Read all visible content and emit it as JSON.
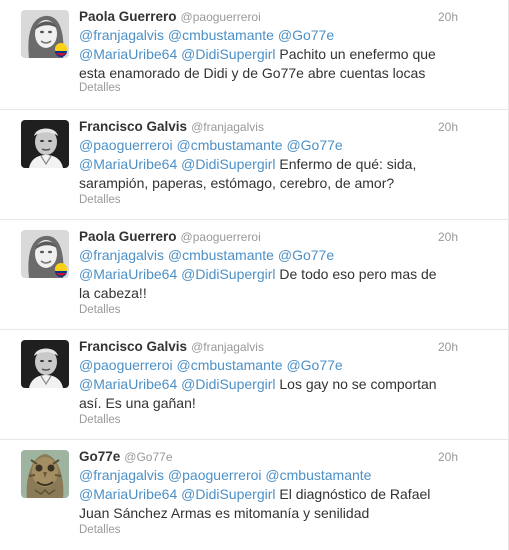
{
  "tweets": [
    {
      "name": "Paola Guerrero",
      "handle": "@paoguerreroi",
      "time": "20h",
      "mentions": [
        "@franjagalvis",
        "@cmbustamante",
        "@Go77e",
        "@MariaUribe64",
        "@DidiSupergirl"
      ],
      "line1": [
        "@cmbustamante",
        "@Go77e"
      ],
      "line2": [
        "@MariaUribe64",
        "@DidiSupergirl"
      ],
      "body": "Pachito un enefermo que esta enamorado de Didi y de Go77e abre cuentas locas",
      "details": "Detalles",
      "avatar": "woman-with-colombian-flag-avatar"
    },
    {
      "name": "Francisco Galvis",
      "handle": "@franjagalvis",
      "time": "20h",
      "mentions": [
        "@paoguerreroi",
        "@cmbustamante",
        "@Go77e",
        "@MariaUribe64",
        "@DidiSupergirl"
      ],
      "body": "Enfermo de qué: sida, sarampión, paperas, estómago, cerebro, de amor?",
      "details": "Detalles",
      "avatar": "man-grayscale-avatar"
    },
    {
      "name": "Paola Guerrero",
      "handle": "@paoguerreroi",
      "time": "20h",
      "mentions": [
        "@franjagalvis",
        "@cmbustamante",
        "@Go77e",
        "@MariaUribe64",
        "@DidiSupergirl"
      ],
      "body": "De todo eso pero mas de la cabeza!!",
      "details": "Detalles",
      "avatar": "woman-with-colombian-flag-avatar"
    },
    {
      "name": "Francisco Galvis",
      "handle": "@franjagalvis",
      "time": "20h",
      "mentions": [
        "@paoguerreroi",
        "@cmbustamante",
        "@Go77e",
        "@MariaUribe64",
        "@DidiSupergirl"
      ],
      "body": "Los gay no se comportan así. Es una gañan!",
      "details": "Detalles",
      "avatar": "man-grayscale-avatar"
    },
    {
      "name": "Go77e",
      "handle": "@Go77e",
      "time": "20h",
      "mentions": [
        "@franjagalvis",
        "@paoguerreroi",
        "@cmbustamante",
        "@MariaUribe64",
        "@DidiSupergirl"
      ],
      "body": "El diagnóstico de Rafael Juan Sánchez Armas es mitomanía y senilidad",
      "details": "Detalles",
      "avatar": "stone-sculpture-face-avatar"
    }
  ],
  "colors": {
    "link": "#4d90c6",
    "muted": "#999999",
    "text": "#333333",
    "divider": "#e8e8e8"
  }
}
